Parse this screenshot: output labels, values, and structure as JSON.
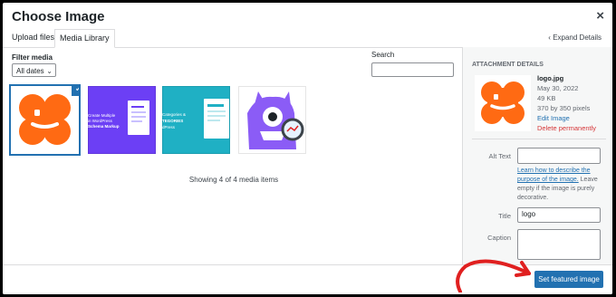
{
  "modal": {
    "title": "Choose Image",
    "close_glyph": "×"
  },
  "tabs": [
    {
      "label": "Upload files"
    },
    {
      "label": "Media Library"
    }
  ],
  "expand": {
    "label": "Expand Details",
    "icon": "chevron-left-icon",
    "glyph": "‹"
  },
  "filter": {
    "label": "Filter media",
    "selected": "All dates"
  },
  "search": {
    "label": "Search",
    "value": ""
  },
  "media": {
    "items": [
      {
        "name": "logo.jpg",
        "selected": true,
        "check_glyph": "✓"
      },
      {
        "name": "",
        "text_lines": [
          "Create Multiple",
          "in WordPress",
          "Schema Markup"
        ]
      },
      {
        "name": "",
        "text_lines": [
          "Categories &",
          "TEGORIES",
          "dPress"
        ]
      },
      {
        "name": "",
        "selected": false
      }
    ],
    "showing_text": "Showing 4 of 4 media items"
  },
  "details": {
    "heading": "ATTACHMENT DETAILS",
    "filename": "logo.jpg",
    "date": "May 30, 2022",
    "size": "49 KB",
    "dimensions": "370 by 350 pixels",
    "edit_label": "Edit Image",
    "delete_label": "Delete permanently",
    "alt_label": "Alt Text",
    "alt_value": "",
    "help_link": "Learn how to describe the purpose of the image.",
    "help_text": " Leave empty if the image is purely decorative.",
    "title_label": "Title",
    "title_value": "logo",
    "caption_label": "Caption",
    "caption_value": ""
  },
  "footer": {
    "primary_button": "Set featured image"
  },
  "colors": {
    "accent": "#2271b1",
    "logo_orange": "#ff6a13",
    "thumb2_purple": "#6c3ff5",
    "thumb3_teal": "#1fb0c4",
    "arrow_red": "#e02020",
    "delete_red": "#d63638"
  }
}
